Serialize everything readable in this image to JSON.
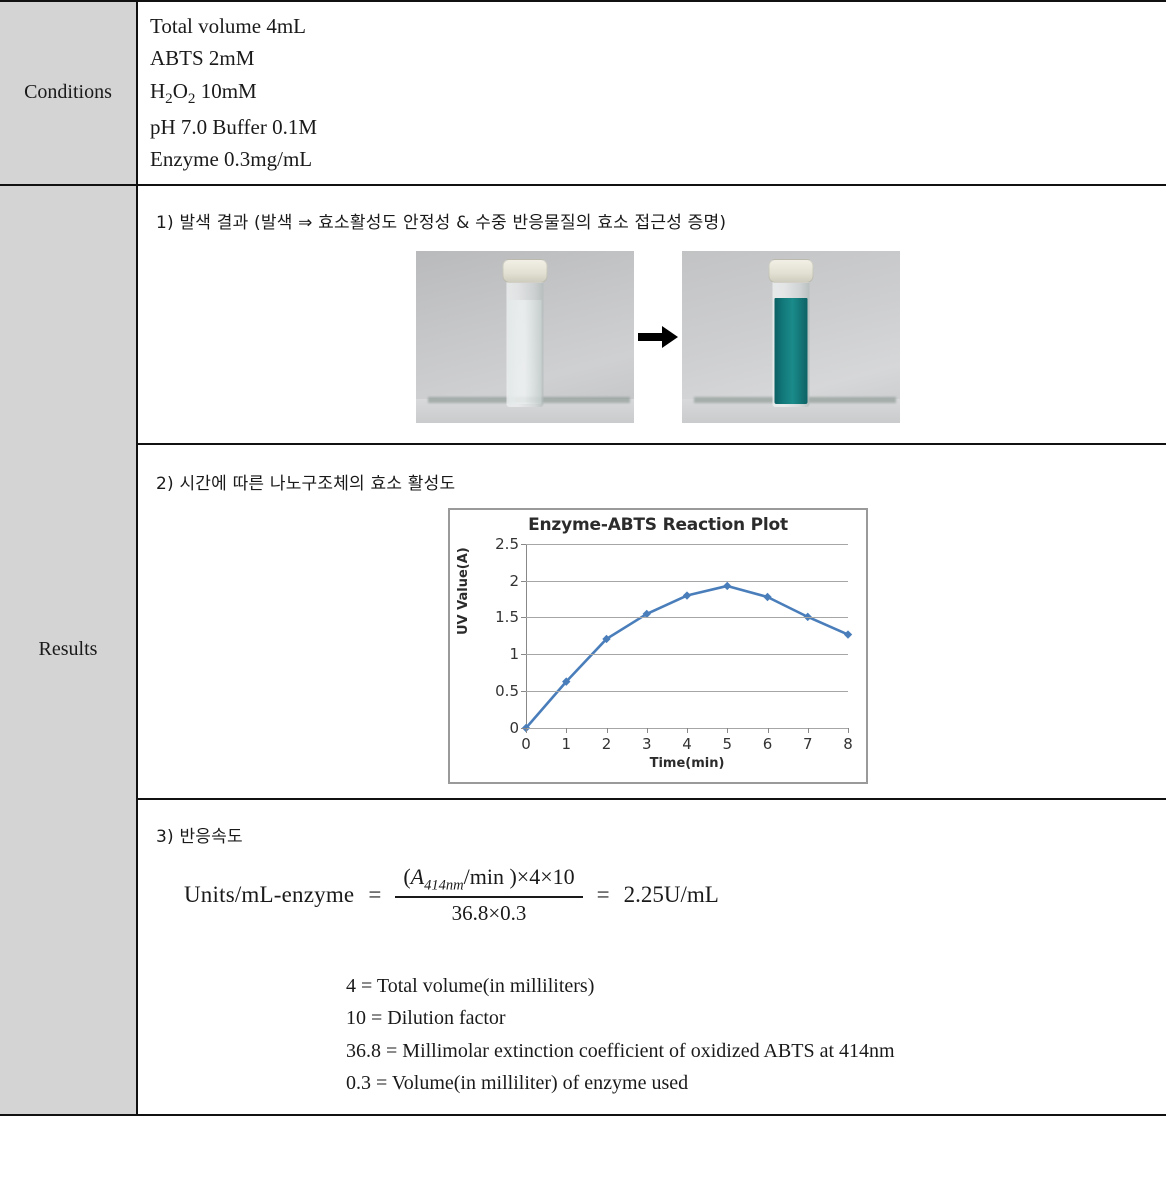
{
  "table": {
    "rows": [
      {
        "label": "Conditions"
      },
      {
        "label": "Results"
      }
    ]
  },
  "conditions": {
    "label": "Conditions",
    "items": [
      {
        "text_before": "Total volume  4mL"
      },
      {
        "text_before": "ABTS  2mM"
      },
      {
        "text_before": "H",
        "sub1": "2",
        "mid": "O",
        "sub2": "2",
        "text_after": "  10mM"
      },
      {
        "text_before": "pH 7.0  Buffer  0.1M"
      },
      {
        "text_before": "Enzyme  0.3mg/mL"
      }
    ],
    "line1": "Total volume  4mL",
    "line2": "ABTS  2mM",
    "line3_a": "H",
    "line3_sub1": "2",
    "line3_b": "O",
    "line3_sub2": "2",
    "line3_c": "  10mM",
    "line4": "pH 7.0  Buffer  0.1M",
    "line5": "Enzyme  0.3mg/mL"
  },
  "results": {
    "label": "Results",
    "section1": {
      "heading": "1) 발색 결과 (발색 ⇒ 효소활성도 안정성 & 수중 반응물질의 효소 접근성 증명)",
      "photo_left_caption": "colorless-cuvette-photo",
      "photo_right_caption": "green-cuvette-photo",
      "arrow": "arrow-right-icon"
    },
    "section2": {
      "heading": "2) 시간에 따른 나노구조체의 효소 활성도"
    },
    "section3": {
      "heading": "3) 반응속도",
      "equation": {
        "lhs": "Units/mL-enzyme",
        "equals": "=",
        "numerator_A": "A",
        "numerator_A_sub": "414nm",
        "numerator_rest": "/min )×4×10",
        "numerator_open": "(",
        "denominator": "36.8×0.3",
        "equals2": "=",
        "rhs": "2.25U/mL"
      },
      "definitions": [
        "4  =  Total volume(in milliliters)",
        "10  =  Dilution factor",
        "36.8  =  Millimolar extinction coefficient of oxidized ABTS at 414nm",
        "0.3  =  Volume(in milliliter) of enzyme used"
      ]
    }
  },
  "chart_data": {
    "type": "line",
    "title": "Enzyme-ABTS Reaction Plot",
    "xlabel": "Time(min)",
    "ylabel": "UV  Value(A)",
    "x": [
      0,
      1,
      2,
      3,
      4,
      5,
      6,
      7,
      8
    ],
    "categories": [
      "0",
      "1",
      "2",
      "3",
      "4",
      "5",
      "6",
      "7",
      "8"
    ],
    "values": [
      0.0,
      0.63,
      1.21,
      1.55,
      1.8,
      1.93,
      1.78,
      1.51,
      1.27
    ],
    "series": [
      {
        "name": "UV Value(A)",
        "values": [
          0.0,
          0.63,
          1.21,
          1.55,
          1.8,
          1.93,
          1.78,
          1.51,
          1.27
        ]
      }
    ],
    "ylim": [
      0,
      2.5
    ],
    "xlim": [
      0,
      8
    ],
    "yticks": [
      0,
      0.5,
      1,
      1.5,
      2,
      2.5
    ],
    "ytick_labels": [
      "0",
      "0.5",
      "1",
      "1.5",
      "2",
      "2.5"
    ],
    "xticks": [
      0,
      1,
      2,
      3,
      4,
      5,
      6,
      7,
      8
    ],
    "xtick_labels": [
      "0",
      "1",
      "2",
      "3",
      "4",
      "5",
      "6",
      "7",
      "8"
    ],
    "grid": "horizontal",
    "legend": "none",
    "series_color": "#4a7ebb",
    "marker": "diamond",
    "gridline_color": "#a6a6a6",
    "plot_border_color": "#9a9a9a"
  },
  "colors": {
    "header_fill": "#d4d4d4",
    "border": "#111111",
    "series_blue": "#4a7ebb",
    "vial_green": "#12787a",
    "text": "#1a1a1a"
  }
}
